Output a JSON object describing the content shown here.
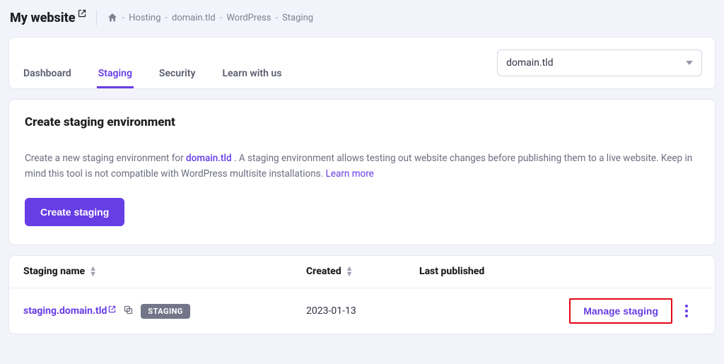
{
  "header": {
    "site_title": "My website",
    "breadcrumbs": [
      "Hosting",
      "domain.tld",
      "WordPress",
      "Staging"
    ]
  },
  "tabs": {
    "items": [
      {
        "label": "Dashboard",
        "active": false
      },
      {
        "label": "Staging",
        "active": true
      },
      {
        "label": "Security",
        "active": false
      },
      {
        "label": "Learn with us",
        "active": false
      }
    ],
    "domain_selected": "domain.tld"
  },
  "create_panel": {
    "title": "Create staging environment",
    "desc_pre": "Create a new staging environment for ",
    "desc_domain": "domain.tld",
    "desc_mid": " . A staging environment allows testing out website changes before publishing them to a live website. Keep in mind this tool is not compatible with WordPress multisite installations. ",
    "learn_more": "Learn more",
    "button": "Create staging"
  },
  "table": {
    "columns": {
      "name": "Staging name",
      "created": "Created",
      "published": "Last published"
    },
    "rows": [
      {
        "name": "staging.domain.tld",
        "badge": "STAGING",
        "created": "2023-01-13",
        "published": "",
        "action": "Manage staging"
      }
    ]
  }
}
